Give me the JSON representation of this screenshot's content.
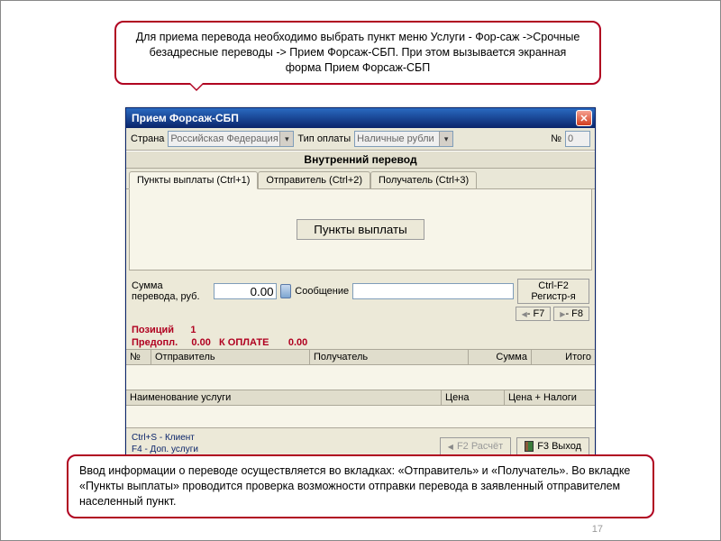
{
  "callout_top": "Для приема перевода необходимо выбрать пункт меню Услуги - Фор-саж ->Срочные безадресные переводы  -> Прием Форсаж-СБП. При этом вызывается экранная форма Прием Форсаж-СБП",
  "window": {
    "title": "Прием Форсаж-СБП",
    "close_glyph": "✕"
  },
  "toolbar": {
    "country_label": "Страна",
    "country_value": "Российская Федерация",
    "paytype_label": "Тип оплаты",
    "paytype_value": "Наличные рубли",
    "num_label": "№",
    "num_value": "0"
  },
  "section_header": "Внутренний перевод",
  "tabs": {
    "tab1": "Пункты выплаты (Ctrl+1)",
    "tab2": "Отправитель (Ctrl+2)",
    "tab3": "Получатель (Ctrl+3)"
  },
  "big_button": "Пункты выплаты",
  "amount_row": {
    "label": "Сумма перевода, руб.",
    "value": "0.00",
    "msg_label": "Сообщение",
    "reg_btn": "Ctrl-F2 Регистр-я"
  },
  "disabled_buttons": {
    "f7": "- F7",
    "f8": "- F8"
  },
  "status": {
    "pos_label": "Позиций",
    "pos_value": "1",
    "prepay_label": "Предопл.",
    "prepay_value": "0.00",
    "topay_label": "К ОПЛАТЕ",
    "topay_value": "0.00"
  },
  "grid1": {
    "col_num": "№",
    "col_sender": "Отправитель",
    "col_recipient": "Получатель",
    "col_sum": "Сумма",
    "col_total": "Итого"
  },
  "grid2": {
    "col_service": "Наименование услуги",
    "col_price": "Цена",
    "col_price_tax": "Цена + Налоги"
  },
  "footer": {
    "hint1": "Ctrl+S - Клиент",
    "hint2": "F4 - Доп. услуги",
    "calc_btn": "F2  Расчёт",
    "exit_btn": "F3  Выход"
  },
  "callout_bottom": "Ввод информации о переводе осуществляется во вкладках: «Отправитель» и «Получатель». Во вкладке «Пункты выплаты» проводится проверка возможности отправки перевода в заявленный отправителем населенный пункт.",
  "page_number": "17"
}
